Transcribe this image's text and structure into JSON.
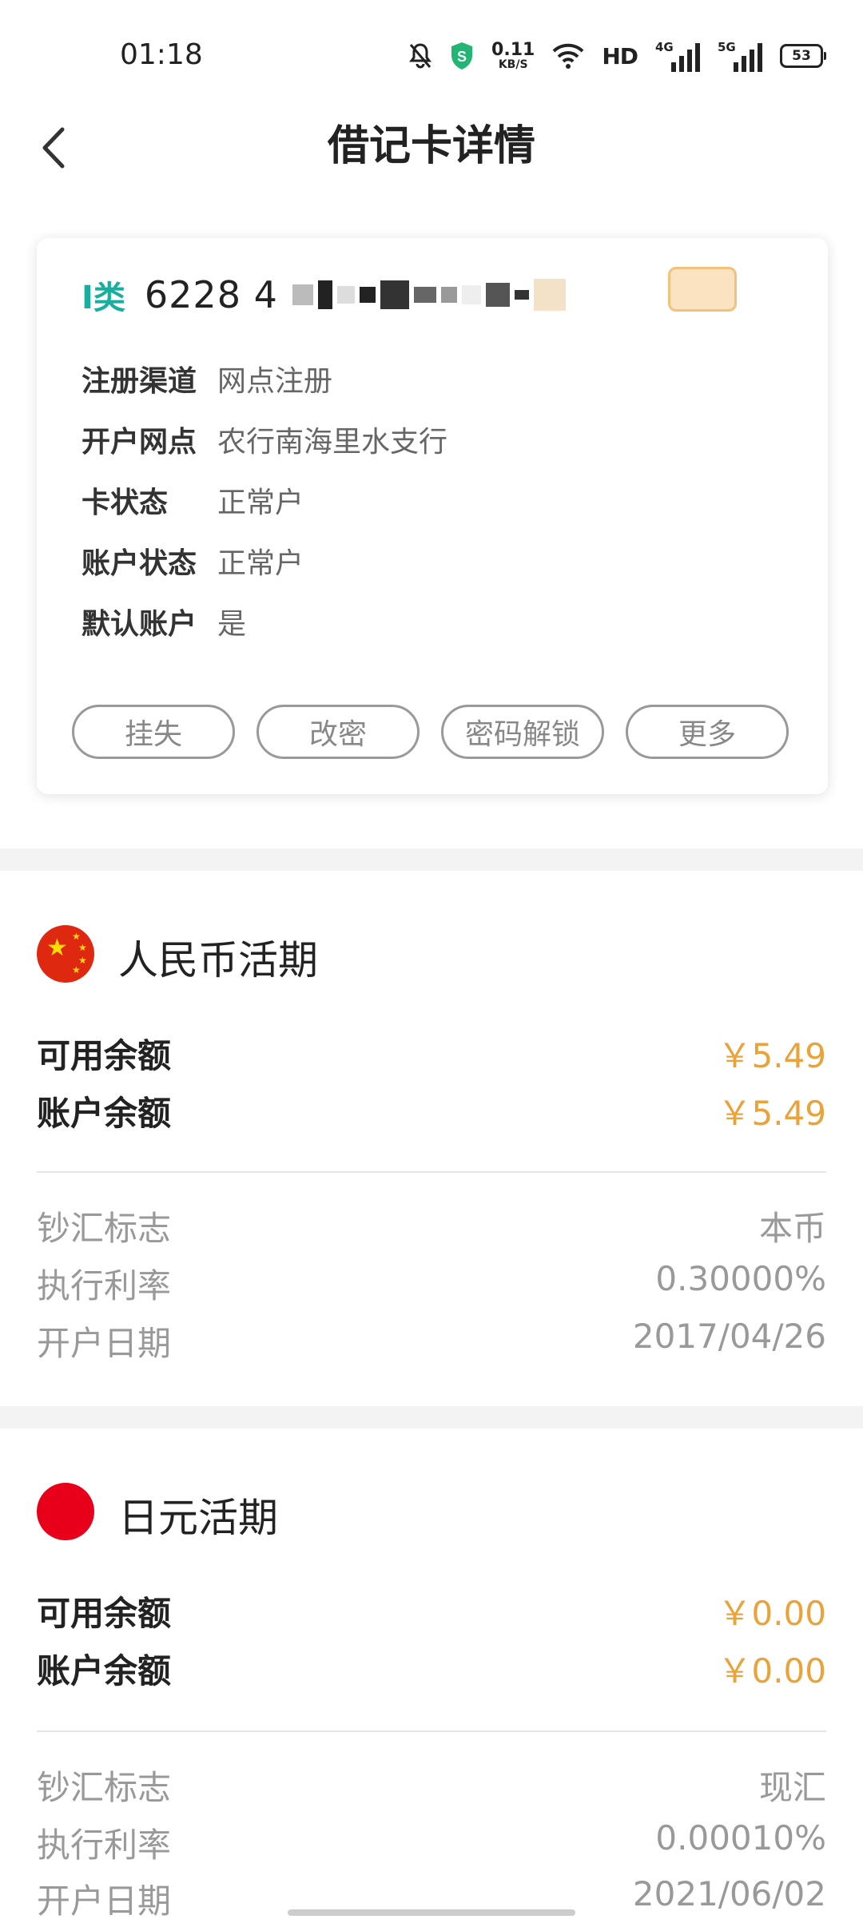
{
  "status_bar": {
    "time": "01:18",
    "net_speed_value": "0.11",
    "net_speed_unit": "KB/S",
    "hd_label": "HD",
    "signal_1_label": "4G",
    "signal_2_label": "5G",
    "battery": "53"
  },
  "nav": {
    "title": "借记卡详情"
  },
  "card": {
    "class_label": "I类",
    "number_prefix": "6228 4",
    "rows": [
      {
        "label": "注册渠道",
        "value": "网点注册"
      },
      {
        "label": "开户网点",
        "value": "农行南海里水支行"
      },
      {
        "label": "卡状态",
        "value": "正常户"
      },
      {
        "label": "账户状态",
        "value": "正常户"
      },
      {
        "label": "默认账户",
        "value": "是"
      }
    ],
    "buttons": [
      "挂失",
      "改密",
      "密码解锁",
      "更多"
    ]
  },
  "accounts": [
    {
      "title": "人民币活期",
      "available_label": "可用余额",
      "available_value": "￥5.49",
      "balance_label": "账户余额",
      "balance_value": "￥5.49",
      "details": [
        {
          "label": "钞汇标志",
          "value": "本币"
        },
        {
          "label": "执行利率",
          "value": "0.30000%"
        },
        {
          "label": "开户日期",
          "value": "2017/04/26"
        }
      ]
    },
    {
      "title": "日元活期",
      "available_label": "可用余额",
      "available_value": "￥0.00",
      "balance_label": "账户余额",
      "balance_value": "￥0.00",
      "details": [
        {
          "label": "钞汇标志",
          "value": "现汇"
        },
        {
          "label": "执行利率",
          "value": "0.00010%"
        },
        {
          "label": "开户日期",
          "value": "2021/06/02"
        }
      ]
    }
  ],
  "colors": {
    "accent_teal": "#1aae9f",
    "amount_orange": "#eaa23a"
  }
}
